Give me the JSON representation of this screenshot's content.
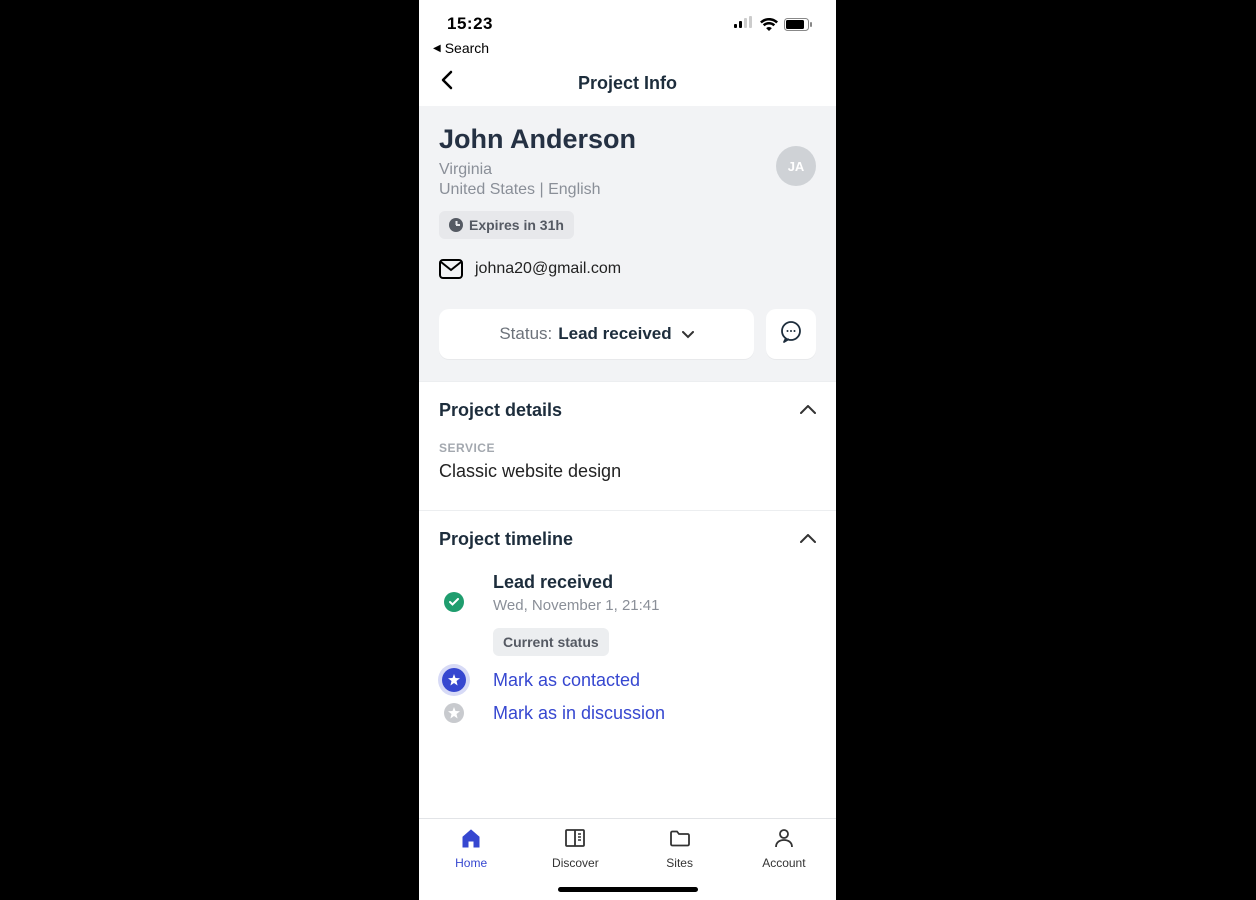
{
  "statusbar": {
    "time": "15:23"
  },
  "backSearch": "Search",
  "nav": {
    "title": "Project Info"
  },
  "profile": {
    "name": "John Anderson",
    "region": "Virginia",
    "country_lang": "United States | English",
    "initials": "JA",
    "expiry": "Expires in 31h",
    "email": "johna20@gmail.com",
    "status_label": "Status:",
    "status_value": "Lead received"
  },
  "details": {
    "header": "Project details",
    "service_label": "SERVICE",
    "service_value": "Classic website design"
  },
  "timeline": {
    "header": "Project timeline",
    "items": [
      {
        "title": "Lead received",
        "date": "Wed, November 1, 21:41",
        "badge": "Current status"
      },
      {
        "title": "Mark as contacted"
      },
      {
        "title": "Mark as in discussion"
      }
    ]
  },
  "tabs": {
    "home": "Home",
    "discover": "Discover",
    "sites": "Sites",
    "account": "Account"
  }
}
